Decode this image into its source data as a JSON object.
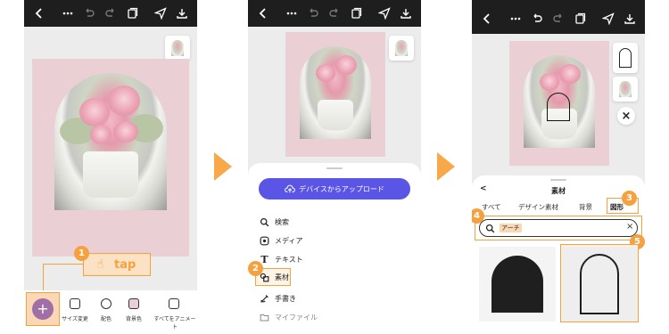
{
  "arrows_color": "#f7a94a",
  "accent": "#f5a13f",
  "step_numbers": [
    "1",
    "2",
    "3",
    "4",
    "5"
  ],
  "panel1": {
    "tap_label": "tap",
    "add_glyph": "+",
    "tools": [
      {
        "label": "サイズ変更",
        "icon": "resize-icon"
      },
      {
        "label": "配色",
        "icon": "palette-icon"
      },
      {
        "label": "背景色",
        "icon": "background-color-icon"
      },
      {
        "label": "すべてをアニメート",
        "icon": "animate-icon"
      }
    ]
  },
  "panel2": {
    "upload_button": "デバイスからアップロード",
    "menu": [
      {
        "label": "検索",
        "icon": "search-icon"
      },
      {
        "label": "メディア",
        "icon": "media-icon"
      },
      {
        "label": "テキスト",
        "icon": "text-icon"
      },
      {
        "label": "素材",
        "icon": "elements-icon"
      },
      {
        "label": "手書き",
        "icon": "draw-icon"
      },
      {
        "label": "マイファイル",
        "icon": "folder-icon"
      }
    ]
  },
  "panel3": {
    "sheet_title": "素材",
    "back_glyph": "<",
    "tabs": [
      "すべて",
      "デザイン素材",
      "背景",
      "図形"
    ],
    "search_value": "アーチ",
    "clear_glyph": "×"
  }
}
